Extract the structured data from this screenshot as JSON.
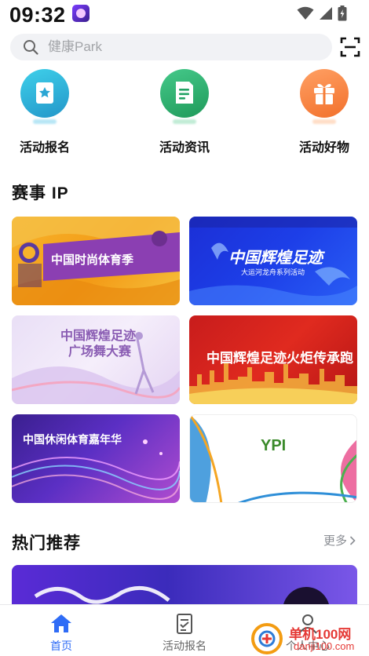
{
  "status_bar": {
    "time": "09:32"
  },
  "search": {
    "placeholder": "健康Park"
  },
  "entries": [
    {
      "label": "活动报名",
      "icon": "star-bookmark-icon",
      "color": "#2bb3d6"
    },
    {
      "label": "活动资讯",
      "icon": "news-icon",
      "color": "#2fb06e"
    },
    {
      "label": "活动好物",
      "icon": "gift-icon",
      "color": "#ff8a3d"
    }
  ],
  "sections": {
    "ip_title": "赛事 IP",
    "hot_title": "热门推荐",
    "more_label": "更多"
  },
  "ip_cards": [
    {
      "title": "中国时尚体育季"
    },
    {
      "title": "中国辉煌足迹",
      "subtitle": "大运河龙舟系列活动"
    },
    {
      "title": "中国辉煌足迹",
      "subtitle": "广场舞大赛"
    },
    {
      "title": "中国辉煌足迹火炬传承跑"
    },
    {
      "title": "中国休闲体育嘉年华"
    },
    {
      "title": "YPI"
    }
  ],
  "tabs": [
    {
      "label": "首页",
      "icon": "home-icon",
      "active": true
    },
    {
      "label": "活动报名",
      "icon": "form-icon",
      "active": false
    },
    {
      "label": "个人中心",
      "icon": "user-icon",
      "active": false
    }
  ],
  "watermark": {
    "title": "单机100网",
    "url": "danji100.com"
  }
}
